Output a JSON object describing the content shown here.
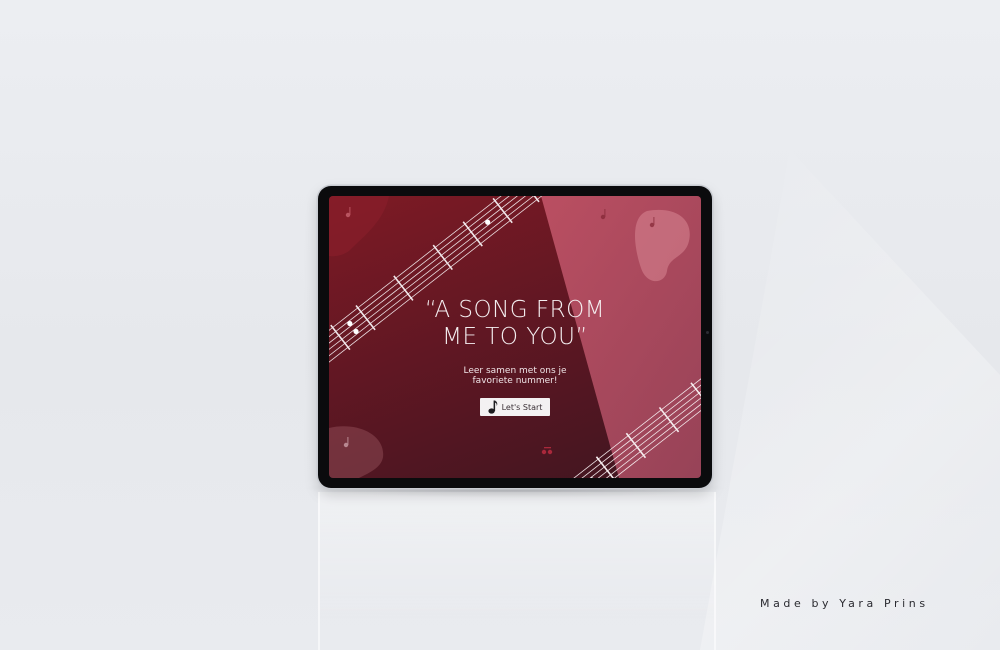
{
  "screen": {
    "headline_line1": "“A SONG FROM",
    "headline_line2": "ME TO YOU”",
    "subtitle_line1": "Leer samen met ons je",
    "subtitle_line2": "favoriete nummer!",
    "start_button_label": "Let's Start",
    "start_button_icon": "music-note-icon"
  },
  "signature": "Made by Yara Prins",
  "colors": {
    "screen_red": "#7e1a24",
    "screen_dark": "#3f1520",
    "panel_pink": "#c0566c",
    "button_bg": "#f3f1f2"
  }
}
